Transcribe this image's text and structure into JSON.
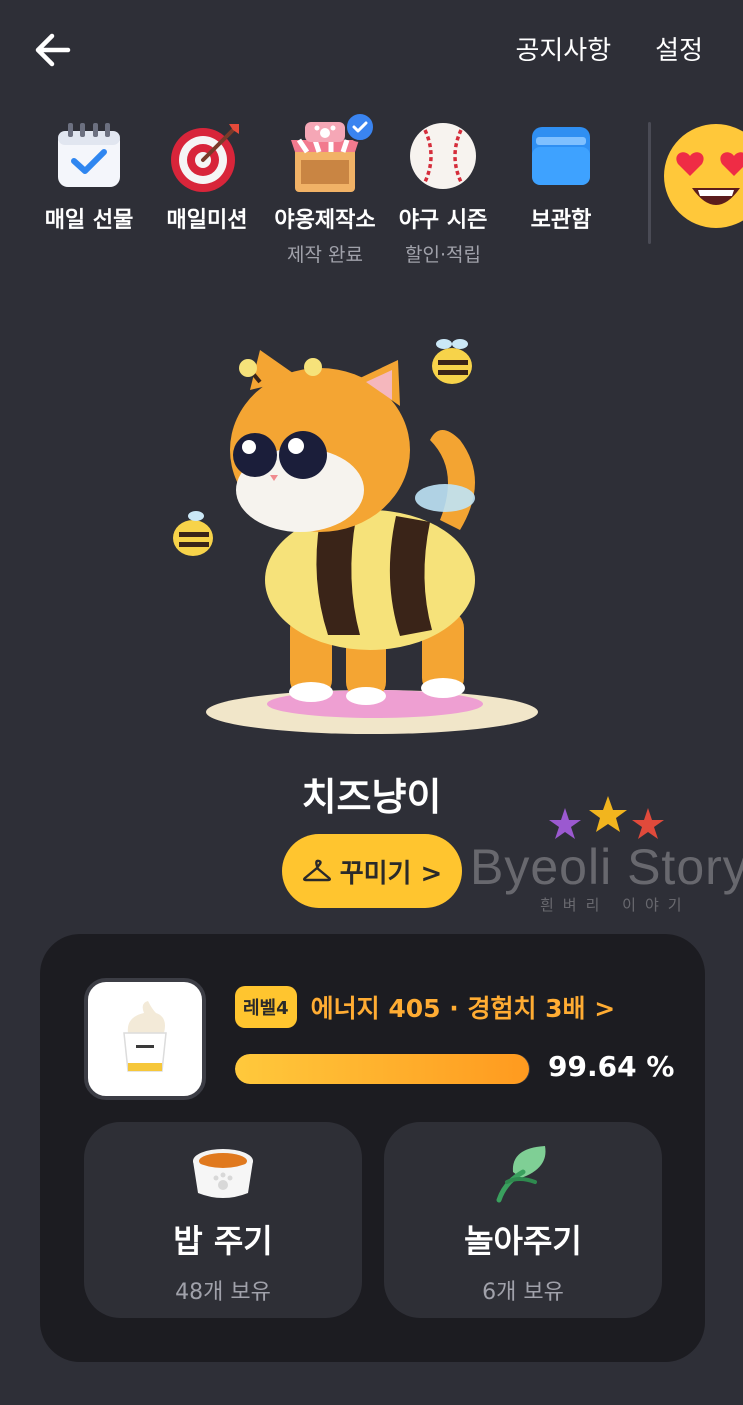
{
  "header": {
    "links": [
      "공지사항",
      "설정"
    ]
  },
  "menu": [
    {
      "label": "매일 선물",
      "sub": "",
      "icon": "calendar-check-icon"
    },
    {
      "label": "매일미션",
      "sub": "",
      "icon": "target-icon"
    },
    {
      "label": "야옹제작소",
      "sub": "제작 완료",
      "icon": "shop-stall-icon",
      "badge": "check"
    },
    {
      "label": "야구 시즌",
      "sub": "할인·적립",
      "icon": "baseball-icon"
    },
    {
      "label": "보관함",
      "sub": "",
      "icon": "folder-icon"
    }
  ],
  "character": {
    "name": "치즈냥이",
    "decorate_label": "꾸미기 >"
  },
  "watermark": {
    "text": "Byeoli Story",
    "sub": "흰벼리 이야기"
  },
  "status": {
    "level_badge": "레벨4",
    "level_text": "에너지 405 · 경험치 3배 >",
    "progress_percent": 99.64,
    "progress_text": "99.64 %"
  },
  "actions": [
    {
      "title": "밥 주기",
      "sub": "48개 보유",
      "icon": "food-bowl-icon"
    },
    {
      "title": "놀아주기",
      "sub": "6개 보유",
      "icon": "leaf-toy-icon"
    }
  ],
  "colors": {
    "background": "#2e2f37",
    "card": "#1c1c21",
    "accent": "#ffc52f",
    "accent_text": "#ffac33"
  }
}
